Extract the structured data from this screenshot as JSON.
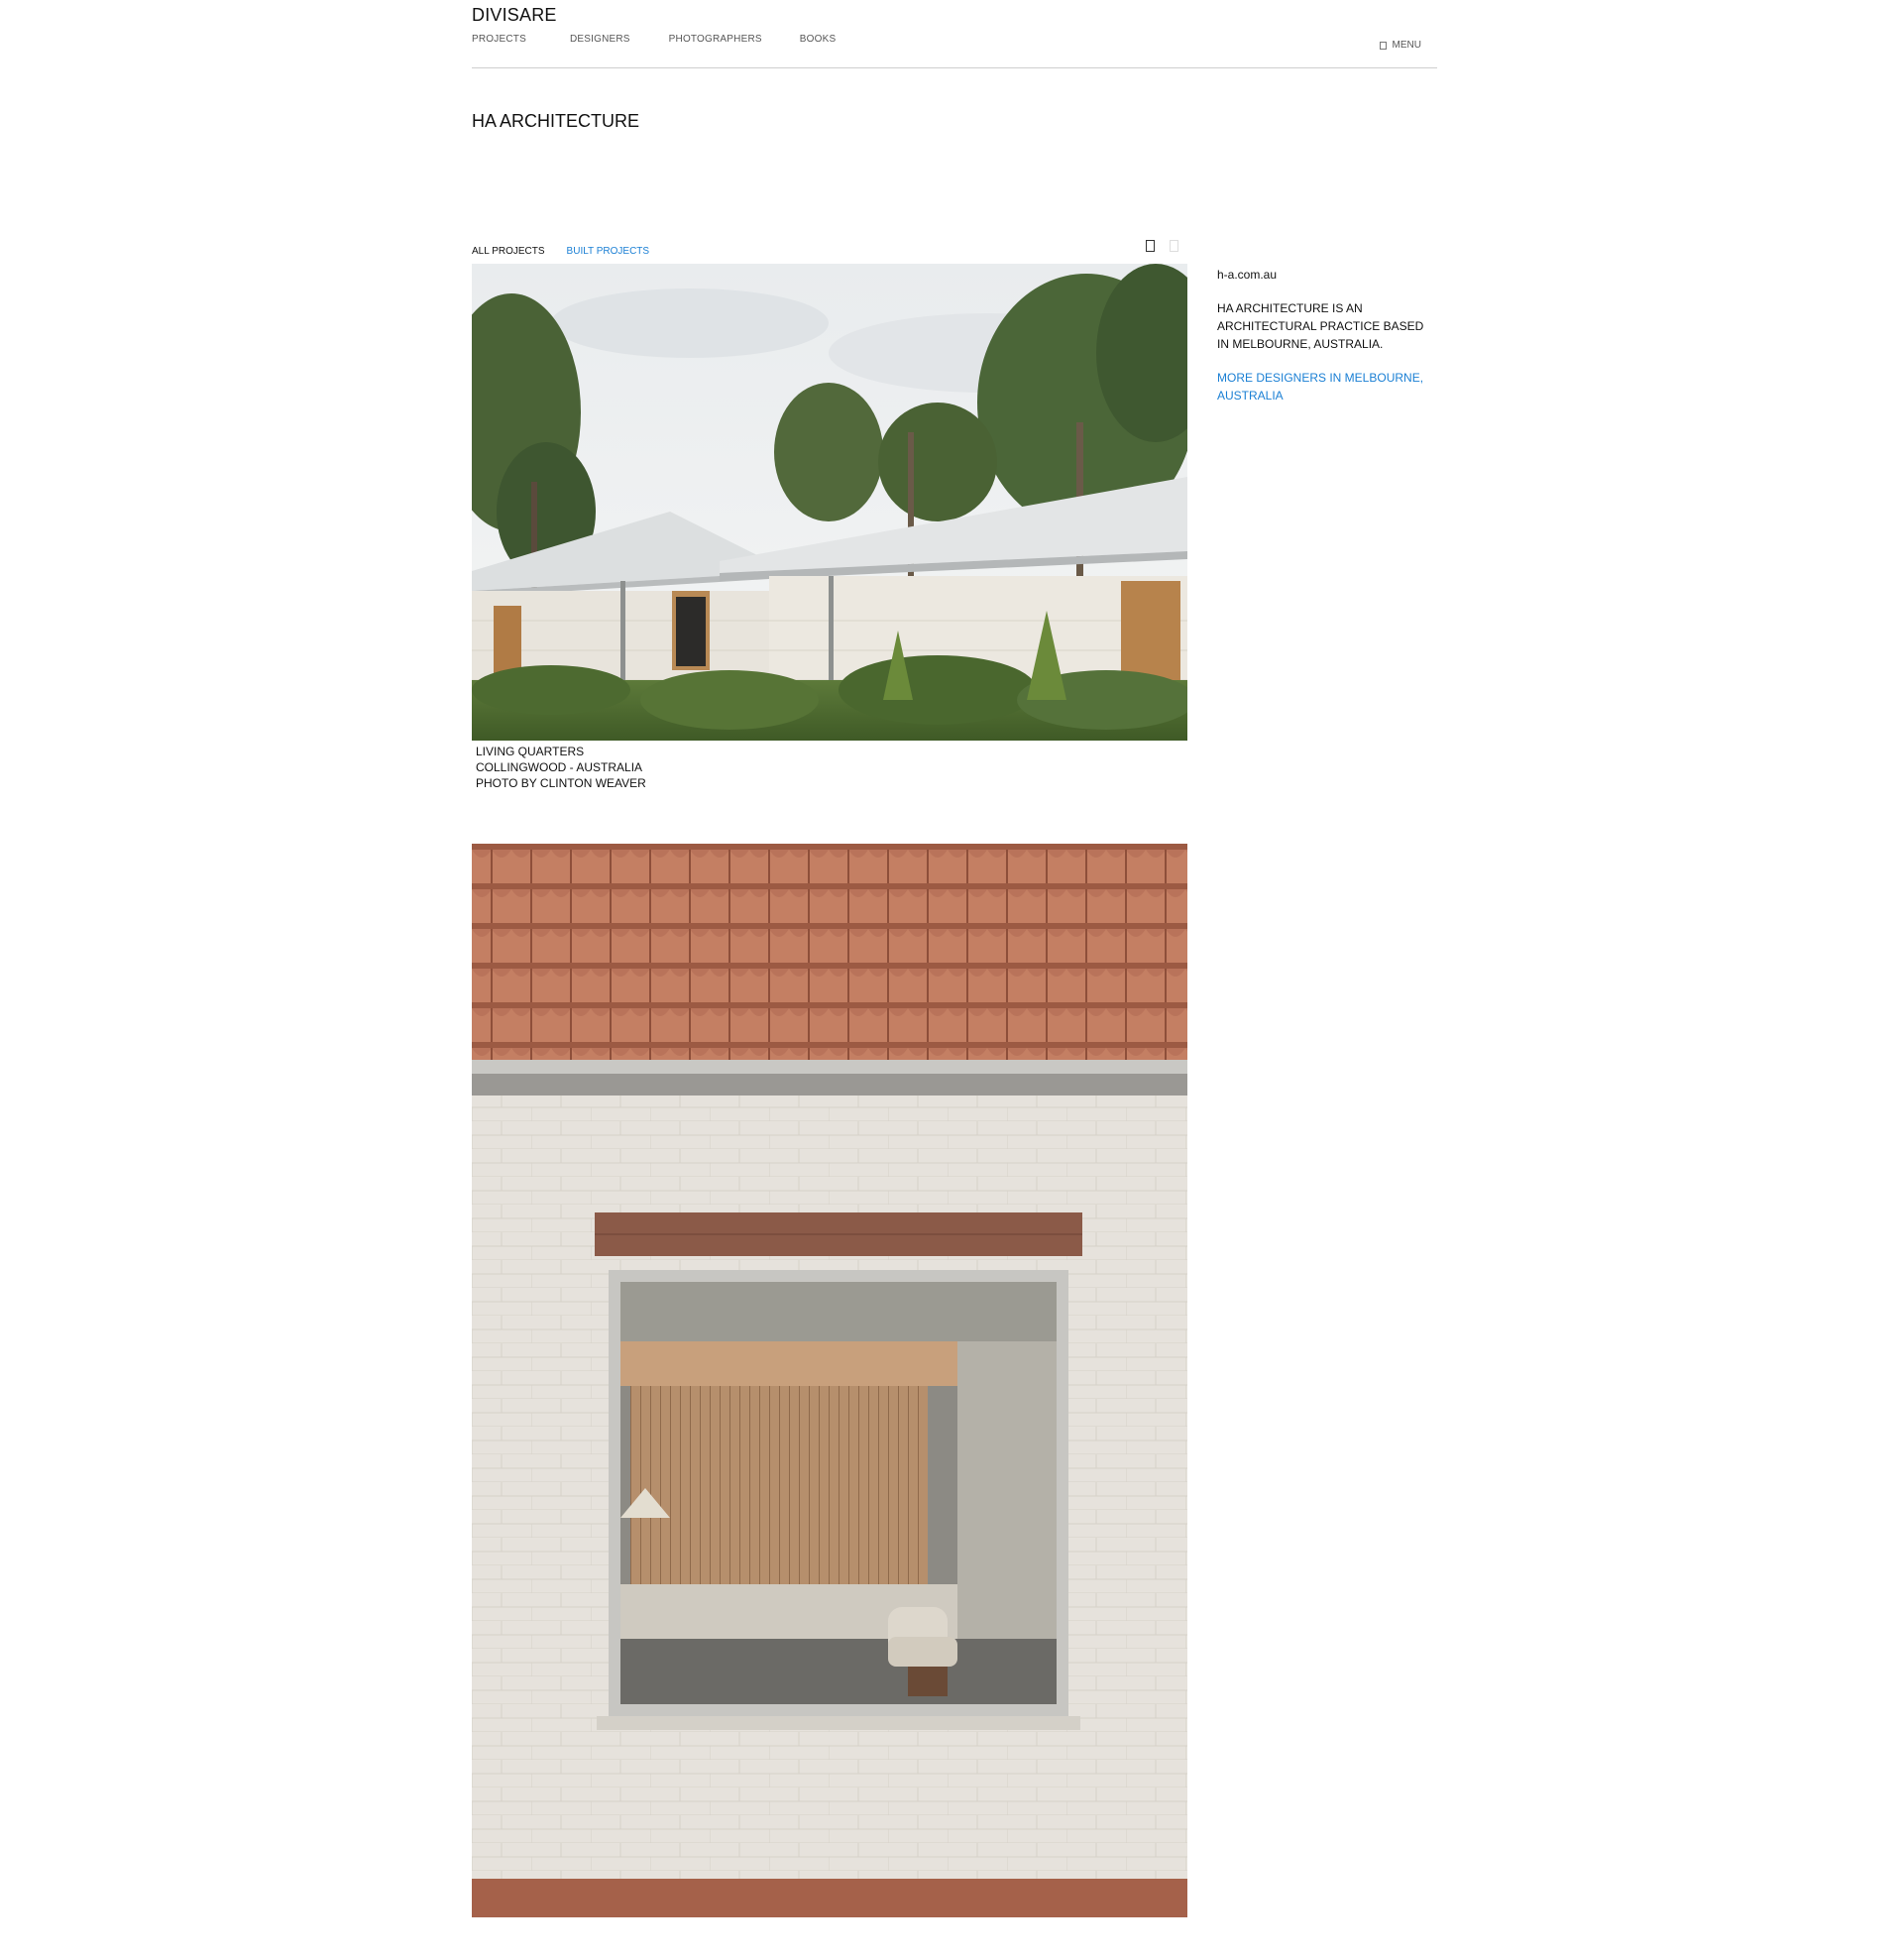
{
  "header": {
    "logo": "DIVISARE",
    "nav": [
      "PROJECTS",
      "DESIGNERS",
      "PHOTOGRAPHERS",
      "BOOKS"
    ],
    "menu_label": "MENU"
  },
  "page": {
    "title": "HA ARCHITECTURE"
  },
  "filters": {
    "all": "ALL PROJECTS",
    "built": "BUILT PROJECTS"
  },
  "sidebar": {
    "website": "h-a.com.au",
    "description": "HA ARCHITECTURE IS AN ARCHITECTURAL PRACTICE BASED IN MELBOURNE, AUSTRALIA.",
    "more_link": "MORE DESIGNERS IN MELBOURNE, AUSTRALIA"
  },
  "projects": [
    {
      "name": "LIVING QUARTERS",
      "location": "COLLINGWOOD - AUSTRALIA",
      "photo_credit": "PHOTO BY CLINTON WEAVER"
    }
  ],
  "colors": {
    "link": "#1a7fd4",
    "text": "#111111",
    "rule": "#cfcfcf"
  },
  "icons": {
    "menu": "menu-icon",
    "grid_view": "grid-view-icon",
    "list_view": "list-view-icon"
  }
}
